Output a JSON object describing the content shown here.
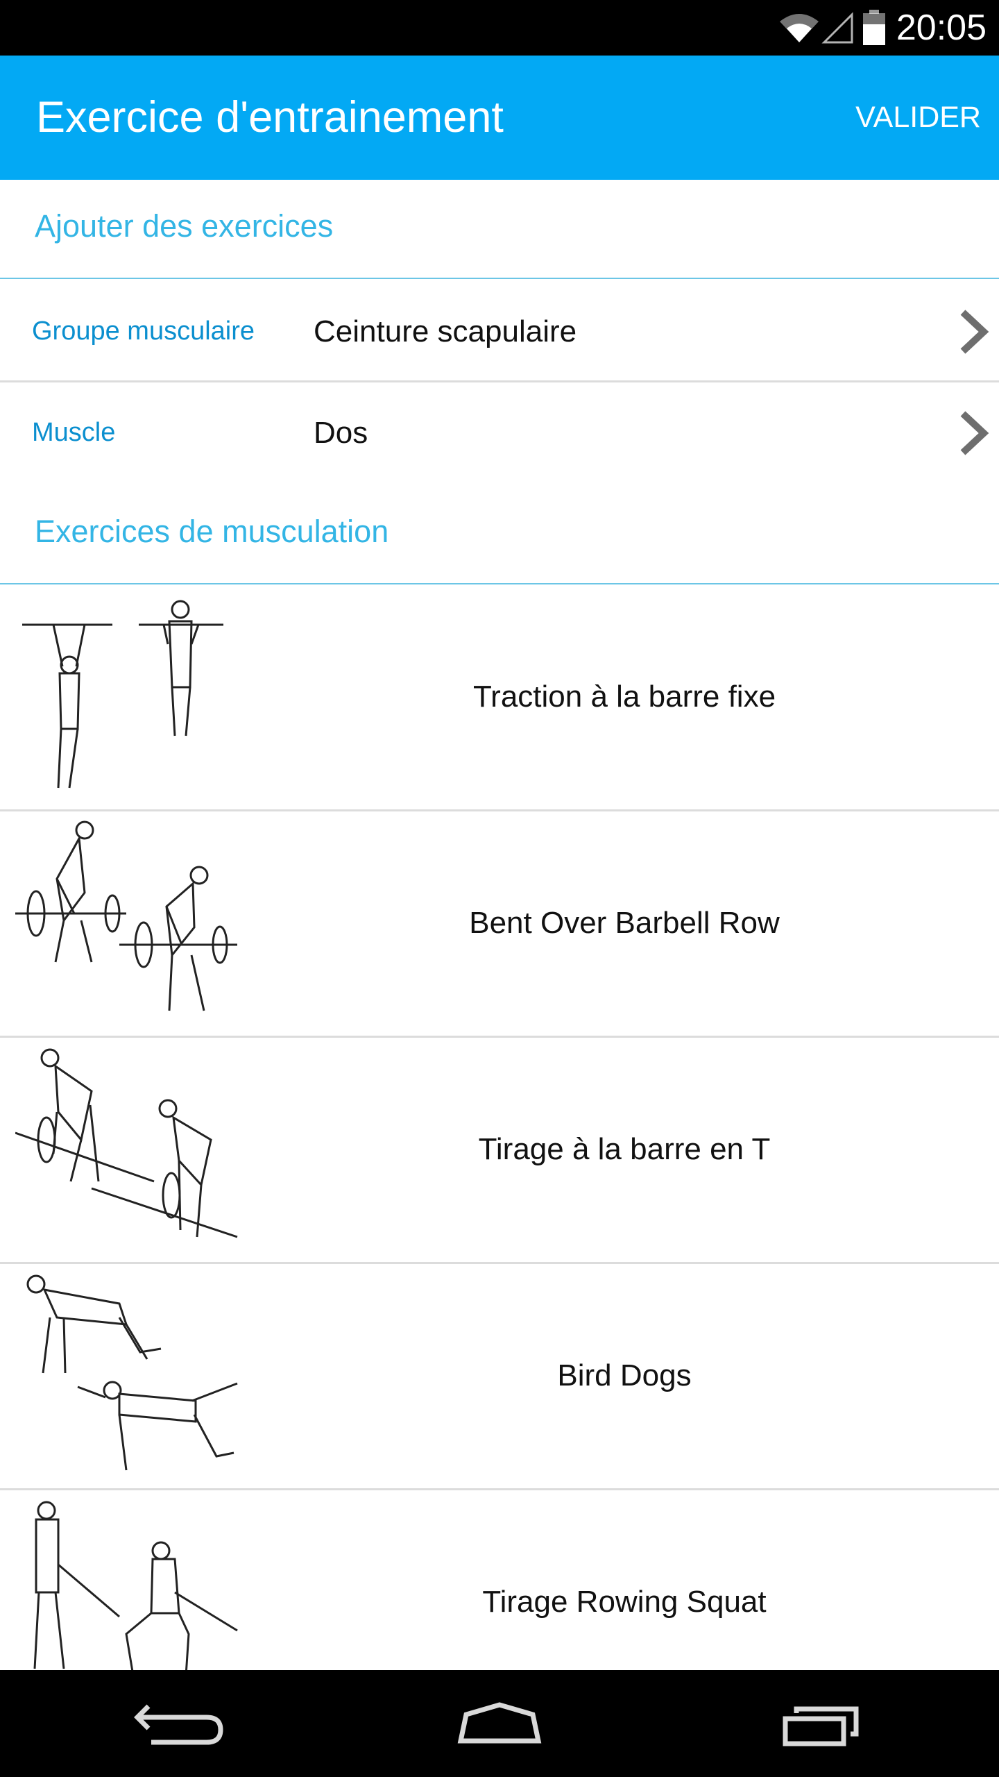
{
  "status_bar": {
    "time": "20:05",
    "icons": [
      "wifi-icon",
      "signal-icon",
      "battery-icon"
    ]
  },
  "app_bar": {
    "title": "Exercice d'entrainement",
    "action_label": "VALIDER"
  },
  "add_section": {
    "header": "Ajouter des exercices"
  },
  "filters": [
    {
      "label": "Groupe musculaire",
      "value": "Ceinture scapulaire"
    },
    {
      "label": "Muscle",
      "value": "Dos"
    }
  ],
  "exercises_section": {
    "header": "Exercices de musculation"
  },
  "exercises": [
    {
      "name": "Traction à la barre fixe",
      "image_icon": "pull-up-illustration"
    },
    {
      "name": "Bent Over Barbell Row",
      "image_icon": "barbell-row-illustration"
    },
    {
      "name": "Tirage à la barre en T",
      "image_icon": "t-bar-row-illustration"
    },
    {
      "name": "Bird Dogs",
      "image_icon": "bird-dog-illustration"
    },
    {
      "name": "Tirage Rowing Squat",
      "image_icon": "squat-row-illustration"
    }
  ],
  "nav_bar": {
    "buttons": [
      "back-icon",
      "home-icon",
      "recent-apps-icon"
    ]
  },
  "colors": {
    "primary": "#03a9f4",
    "section_text": "#33b5e5",
    "label_text": "#0b8fcf",
    "status_bar": "#000000"
  }
}
